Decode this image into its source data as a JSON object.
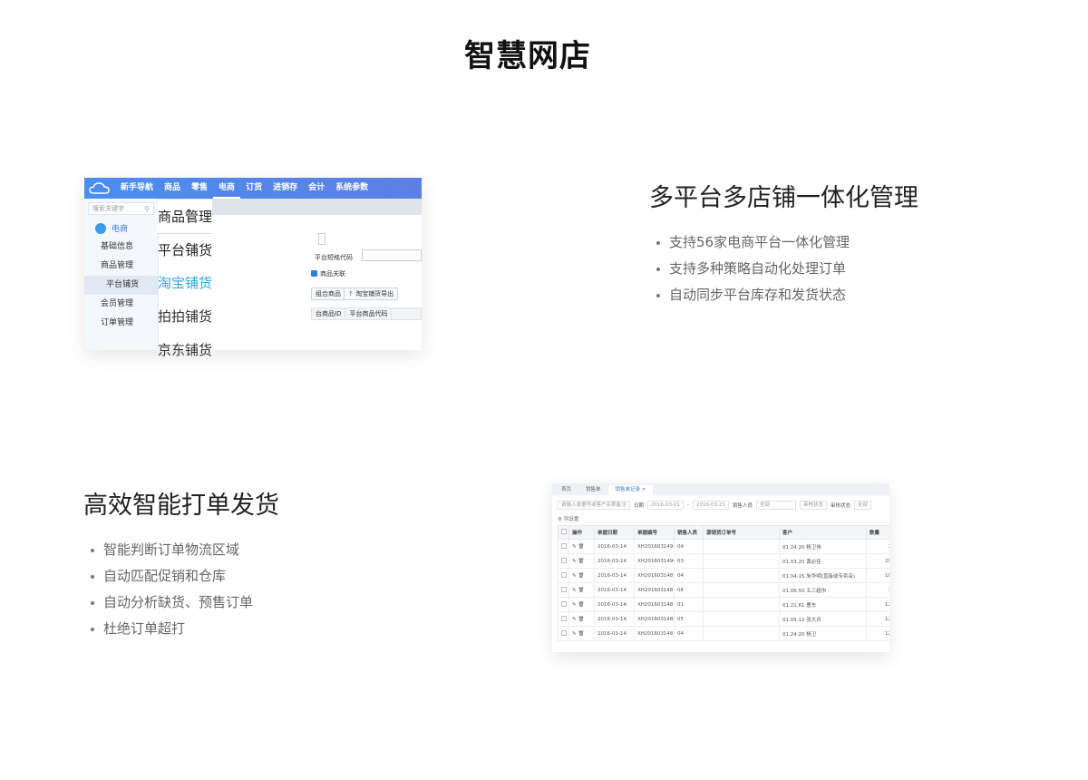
{
  "page": {
    "title": "智慧网店"
  },
  "section1": {
    "title": "多平台多店铺一体化管理",
    "bullets": [
      "支持56家电商平台一体化管理",
      "支持多种策略自动化处理订单",
      "自动同步平台库存和发货状态"
    ],
    "screenshot": {
      "nav": [
        "新手导航",
        "商品",
        "零售",
        "电商",
        "订货",
        "进销存",
        "会计",
        "系统参数"
      ],
      "nav_active_index": 3,
      "search_placeholder": "搜索关键字",
      "sidebar_header": "电商",
      "sidebar_items": [
        "基础信息",
        "商品管理",
        "平台铺货",
        "会员管理",
        "订单管理"
      ],
      "sidebar_selected": "平台铺货",
      "content": {
        "platform_code_label": "平台短格代码",
        "goods_link_label": "商品关联",
        "btn_merge": "组合商品",
        "btn_export": "淘宝铺货导出",
        "col_goods_id": "台商品ID",
        "col_platform_code": "平台商品代码"
      },
      "dropdown": {
        "header": "商品管理",
        "sub": "平台铺货",
        "options": [
          "淘宝铺货",
          "拍拍铺货",
          "京东铺货"
        ],
        "active_option": "淘宝铺货"
      }
    }
  },
  "section2": {
    "title": "高效智能打单发货",
    "bullets": [
      "智能判断订单物流区域",
      "自动匹配促销和仓库",
      "自动分析缺货、预售订单",
      "杜绝订单超打"
    ],
    "screenshot": {
      "tabs": [
        "首页",
        "销售单",
        "销售单记录"
      ],
      "active_tab": "销售单记录",
      "filter": {
        "search_placeholder": "请输入单据号或客户名称备注",
        "date_label": "日期",
        "date_from": "2016-03-01",
        "date_to": "2016-03-21",
        "salesman_label": "销售人员",
        "salesman_value": "全部",
        "audit_status": "审核状态",
        "audit_label": "审核状态",
        "audit_value": "全部"
      },
      "column_settings": "列设置",
      "columns": [
        "",
        "操作",
        "单据日期",
        "单据编号",
        "销售人员",
        "源销货订单号",
        "客户",
        "数量"
      ],
      "rows": [
        [
          "2016-03-14",
          "XH2016031491",
          "04",
          "",
          "01.24.20 杨卫伟",
          "1"
        ],
        [
          "2016-03-14",
          "XH2016031490",
          "03",
          "",
          "01.03.20 黄必佳",
          "29"
        ],
        [
          "2016-03-14",
          "XH2016031489",
          "04",
          "",
          "01.04.15 朱华明(直接或专卖店)",
          "10"
        ],
        [
          "2016-03-14",
          "XH2016031488",
          "06",
          "",
          "01.06.50 五三超市",
          "1"
        ],
        [
          "2016-03-14",
          "XH2016031487",
          "01",
          "",
          "01.21.61 曹东",
          "12"
        ],
        [
          "2016-03-14",
          "XH2016031486",
          "05",
          "",
          "01.05.12 张大兵",
          "12"
        ],
        [
          "2016-03-14",
          "XH2016031485",
          "04",
          "",
          "01.24.20 杨卫",
          "12"
        ]
      ]
    }
  },
  "colors": {
    "accent": "#2f7de1",
    "nav_gradient_start": "#4a8ef0",
    "nav_gradient_end": "#5d7fe4",
    "highlight": "#2fa6e0"
  }
}
